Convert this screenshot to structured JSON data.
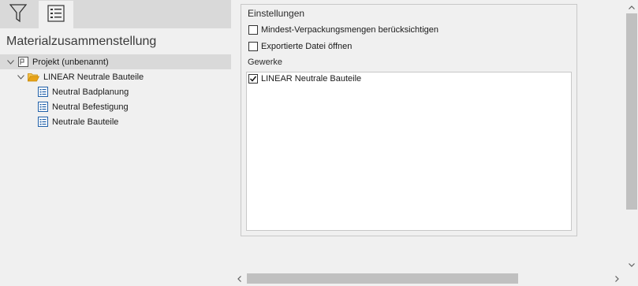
{
  "left_panel": {
    "title": "Materialzusammenstellung",
    "tree": [
      {
        "label": "Projekt (unbenannt)",
        "level": 0,
        "expanded": true,
        "icon": "project-icon",
        "selected": true
      },
      {
        "label": "LINEAR Neutrale Bauteile",
        "level": 1,
        "expanded": true,
        "icon": "folder-open-icon",
        "selected": false
      },
      {
        "label": "Neutral Badplanung",
        "level": 2,
        "icon": "list-icon",
        "selected": false
      },
      {
        "label": "Neutral Befestigung",
        "level": 2,
        "icon": "list-icon",
        "selected": false
      },
      {
        "label": "Neutrale Bauteile",
        "level": 2,
        "icon": "list-icon",
        "selected": false
      }
    ]
  },
  "settings": {
    "title": "Einstellungen",
    "options": [
      {
        "label": "Mindest-Verpackungsmengen berücksichtigen",
        "checked": false
      },
      {
        "label": "Exportierte Datei öffnen",
        "checked": false
      }
    ],
    "gewerke_label": "Gewerke",
    "gewerke": [
      {
        "label": "LINEAR Neutrale Bauteile",
        "checked": true
      }
    ]
  },
  "colors": {
    "folder": "#e8a317",
    "list_icon": "#1f5fa8",
    "selection": "#d9d9d9"
  }
}
